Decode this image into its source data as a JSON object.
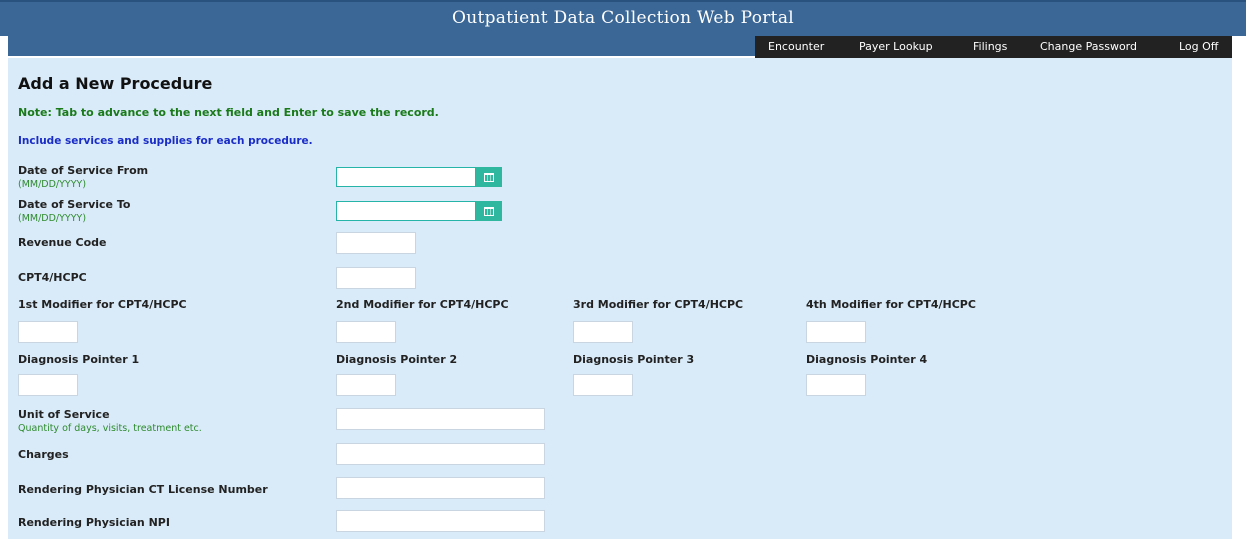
{
  "header": {
    "title": "Outpatient Data Collection Web Portal"
  },
  "nav": {
    "items": [
      {
        "label": "Encounter"
      },
      {
        "label": "Payer Lookup"
      },
      {
        "label": "Filings"
      },
      {
        "label": "Change Password"
      },
      {
        "label": "Log Off"
      }
    ]
  },
  "form": {
    "title": "Add a New Procedure",
    "note": "Note: Tab to advance to the next field and Enter to save the record.",
    "instruction": "Include services and supplies for each procedure.",
    "date_from": {
      "label": "Date of Service From",
      "hint": "(MM/DD/YYYY)",
      "value": ""
    },
    "date_to": {
      "label": "Date of Service To",
      "hint": "(MM/DD/YYYY)",
      "value": ""
    },
    "revenue_code": {
      "label": "Revenue Code",
      "value": ""
    },
    "cpt4_hcpc": {
      "label": "CPT4/HCPC",
      "value": ""
    },
    "modifiers": [
      {
        "label": "1st Modifier for CPT4/HCPC",
        "value": ""
      },
      {
        "label": "2nd Modifier for CPT4/HCPC",
        "value": ""
      },
      {
        "label": "3rd Modifier for CPT4/HCPC",
        "value": ""
      },
      {
        "label": "4th Modifier for CPT4/HCPC",
        "value": ""
      }
    ],
    "diagnosis_pointers": [
      {
        "label": "Diagnosis Pointer 1",
        "value": ""
      },
      {
        "label": "Diagnosis Pointer 2",
        "value": ""
      },
      {
        "label": "Diagnosis Pointer 3",
        "value": ""
      },
      {
        "label": "Diagnosis Pointer 4",
        "value": ""
      }
    ],
    "unit_of_service": {
      "label": "Unit of Service",
      "hint": "Quantity of days, visits, treatment etc.",
      "value": ""
    },
    "charges": {
      "label": "Charges",
      "value": ""
    },
    "license_number": {
      "label": "Rendering Physician CT License Number",
      "value": ""
    },
    "npi": {
      "label": "Rendering Physician NPI",
      "value": ""
    }
  },
  "colors": {
    "header_bg": "#3b6797",
    "nav_bg": "#222222",
    "content_bg": "#d9ebf8",
    "note_green": "#1a7a1a",
    "note_blue": "#1a2cc7",
    "calendar_button": "#2fb89f"
  }
}
